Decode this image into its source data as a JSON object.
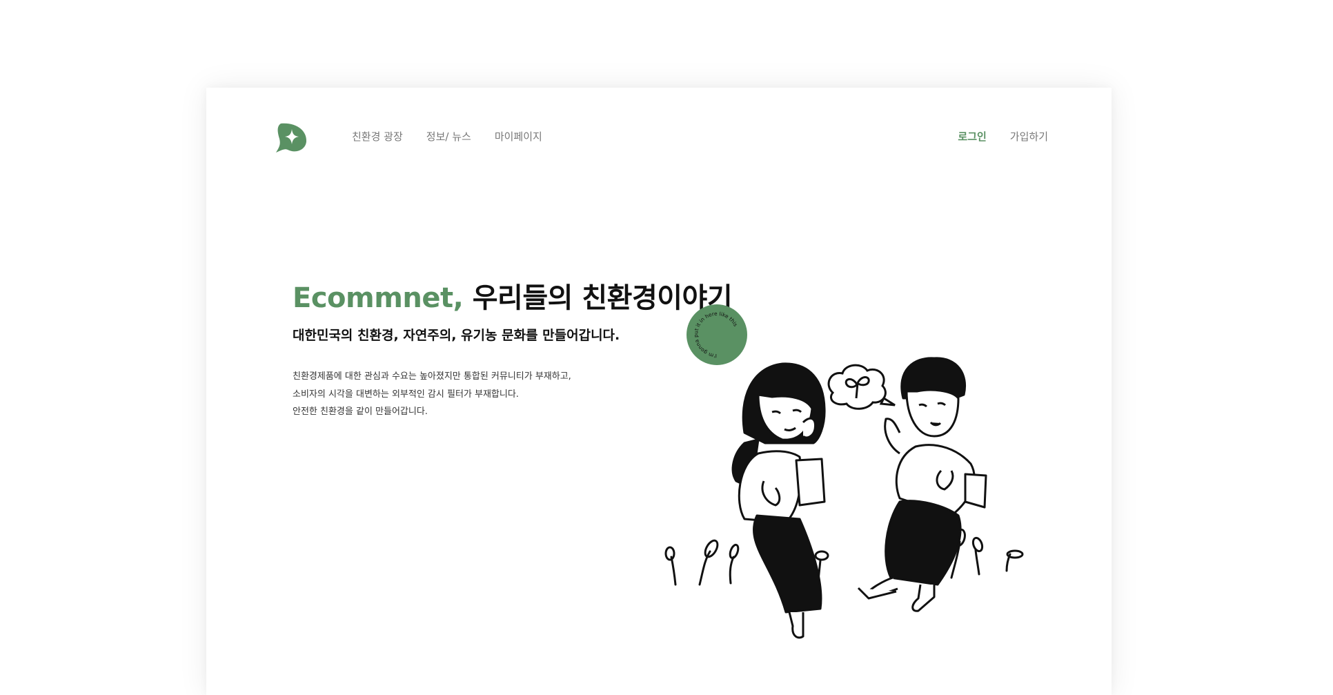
{
  "colors": {
    "accent": "#5a9163",
    "text": "#111111",
    "muted": "#777777"
  },
  "nav": {
    "logo_icon": "leaf-logo-icon",
    "links": [
      "친환경 광장",
      "정보/ 뉴스",
      "마이페이지"
    ]
  },
  "auth": {
    "login": "로그인",
    "signup": "가입하기"
  },
  "hero": {
    "brand": "Ecommnet,",
    "title_rest": " 우리들의 친환경이야기",
    "subtitle": "대한민국의 친환경, 자연주의, 유기농 문화를 만들어갑니다.",
    "body": [
      "친환경제품에 대한 관심과 수요는 높아졌지만 통합된 커뮤니티가 부재하고,",
      "소비자의 시각을 대변하는 외부적인 감시 필터가 부재합니다.",
      "안전한 친환경을 같이 만들어갑니다."
    ],
    "badge_text": "I'm gonna put it in here like this"
  }
}
